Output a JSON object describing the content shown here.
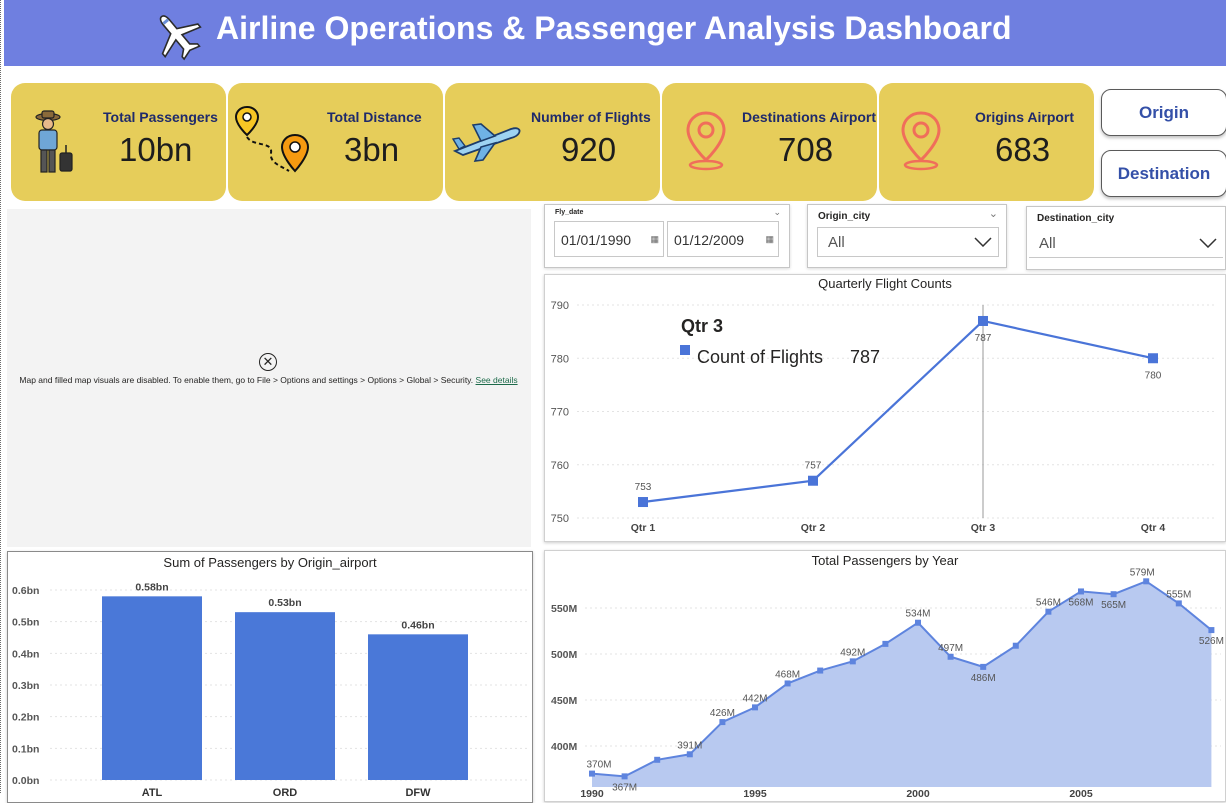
{
  "header": {
    "title": "Airline Operations & Passenger Analysis Dashboard",
    "logo_icon": "airplane-icon",
    "bg_color": "#6f7fe0"
  },
  "cards": [
    {
      "label": "Total Passengers",
      "value": "10bn",
      "icon": "traveler-icon"
    },
    {
      "label": "Total Distance",
      "value": "3bn",
      "icon": "route-pin-icon"
    },
    {
      "label": "Number of Flights",
      "value": "920",
      "icon": "plane-icon"
    },
    {
      "label": "Destinations Airport",
      "value": "708",
      "icon": "location-pin-icon"
    },
    {
      "label": "Origins Airport",
      "value": "683",
      "icon": "location-pin-icon"
    }
  ],
  "nav_buttons": {
    "origin": "Origin",
    "destination": "Destination"
  },
  "map": {
    "message": "Map and filled map visuals are disabled. To enable them, go to File > Options and settings > Options > Global > Security.",
    "link": "See details"
  },
  "slicers": {
    "fly_date": {
      "title": "Fly_date",
      "start": "01/01/1990",
      "end": "01/12/2009"
    },
    "origin_city": {
      "title": "Origin_city",
      "value": "All"
    },
    "destination_city": {
      "title": "Destination_city",
      "value": "All"
    }
  },
  "chart_data": [
    {
      "type": "line",
      "title": "Quarterly Flight Counts",
      "categories": [
        "Qtr 1",
        "Qtr 2",
        "Qtr 3",
        "Qtr 4"
      ],
      "series": [
        {
          "name": "Count of Flights",
          "values": [
            753,
            757,
            787,
            780
          ]
        }
      ],
      "yticks": [
        750,
        760,
        770,
        780,
        790
      ],
      "ylim": [
        750,
        790
      ],
      "tooltip": {
        "title": "Qtr 3",
        "label": "Count of Flights",
        "value": "787"
      },
      "color": "#4a74d8"
    },
    {
      "type": "bar",
      "title": "Sum of Passengers by Origin_airport",
      "categories": [
        "ATL",
        "ORD",
        "DFW"
      ],
      "values": [
        0.58,
        0.53,
        0.46
      ],
      "value_labels": [
        "0.58bn",
        "0.53bn",
        "0.46bn"
      ],
      "yticks": [
        "0.0bn",
        "0.1bn",
        "0.2bn",
        "0.3bn",
        "0.4bn",
        "0.5bn",
        "0.6bn"
      ],
      "ylim": [
        0,
        0.6
      ],
      "color": "#4a78d8"
    },
    {
      "type": "area",
      "title": "Total Passengers by Year",
      "x": [
        1990,
        1991,
        1992,
        1993,
        1994,
        1995,
        1996,
        1997,
        1998,
        1999,
        2000,
        2001,
        2002,
        2003,
        2004,
        2005,
        2006,
        2007,
        2008,
        2009
      ],
      "values": [
        370,
        367,
        385,
        391,
        426,
        442,
        468,
        482,
        492,
        511,
        534,
        497,
        486,
        509,
        546,
        568,
        565,
        579,
        555,
        526
      ],
      "labels": [
        "370M",
        "367M",
        "",
        "391M",
        "426M",
        "442M",
        "468M",
        "",
        "492M",
        "",
        "534M",
        "497M",
        "486M",
        "",
        "546M",
        "568M",
        "565M",
        "579M",
        "555M",
        "526M"
      ],
      "xticks": [
        1990,
        1995,
        2000,
        2005
      ],
      "yticks": [
        "400M",
        "450M",
        "500M",
        "550M"
      ],
      "color": "#5e84de",
      "fill": "#b8c9f0"
    }
  ]
}
